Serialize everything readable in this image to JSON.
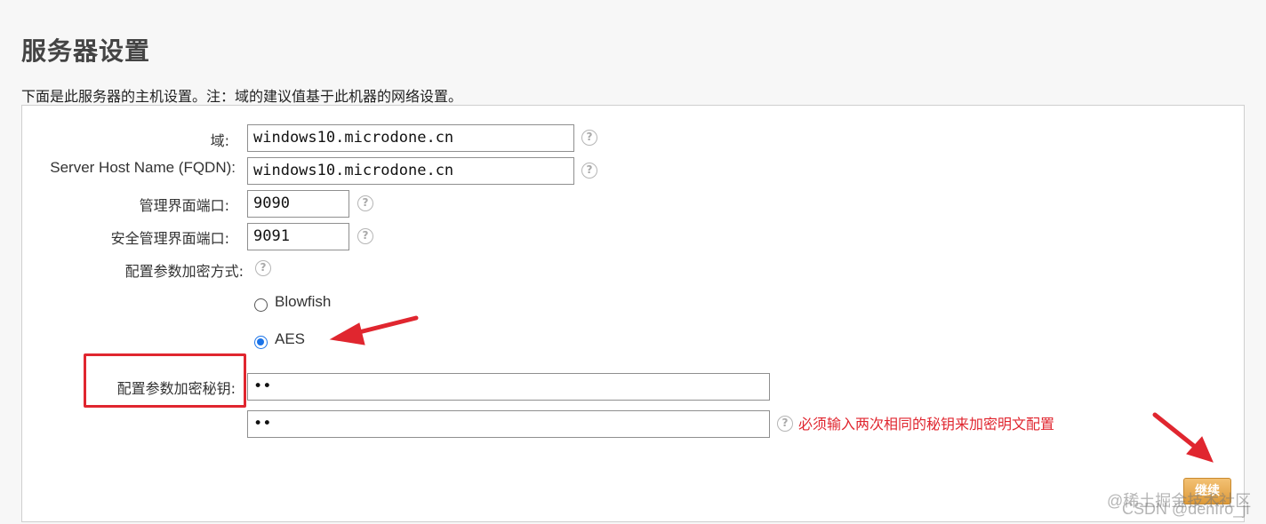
{
  "page": {
    "title": "服务器设置",
    "description": "下面是此服务器的主机设置。注：域的建议值基于此机器的网络设置。"
  },
  "form": {
    "domain": {
      "label": "域:",
      "value": "windows10.microdone.cn"
    },
    "fqdn": {
      "label": "Server Host Name (FQDN):",
      "value": "windows10.microdone.cn"
    },
    "admin_port": {
      "label": "管理界面端口:",
      "value": "9090"
    },
    "secure_admin_port": {
      "label": "安全管理界面端口:",
      "value": "9091"
    },
    "encryption_method": {
      "label": "配置参数加密方式:",
      "options": [
        {
          "label": "Blowfish",
          "checked": false
        },
        {
          "label": "AES",
          "checked": true
        }
      ]
    },
    "encryption_key": {
      "label": "配置参数加密秘钥:",
      "value": "••",
      "confirm_value": "••",
      "error": "必须输入两次相同的秘钥来加密明文配置"
    },
    "help_glyph": "?",
    "continue_label": "继续"
  },
  "annotations": {
    "highlight_color": "#e0262f"
  },
  "watermark": {
    "line1": "@稀土掘金技术社区",
    "line2": "CSDN @denfro_ji"
  }
}
